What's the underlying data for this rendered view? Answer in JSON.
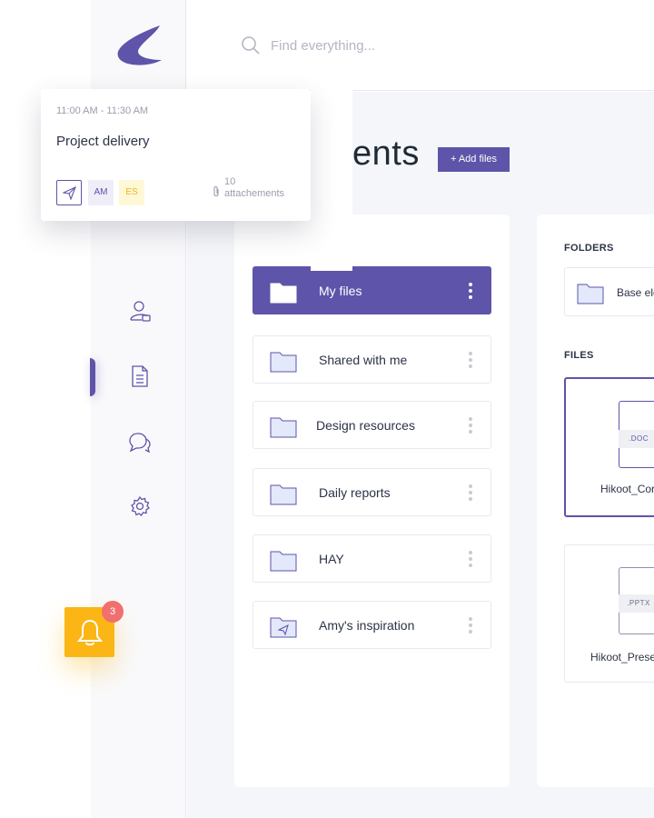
{
  "app": {
    "brand_color": "#5e54a9",
    "accent_yellow": "#fbb616",
    "badge_red": "#f0706d"
  },
  "search": {
    "placeholder": "Find everything..."
  },
  "page": {
    "title_visible": "ents",
    "add_files_label": "+ Add files"
  },
  "sidebar": {
    "icons": [
      "user-badge-icon",
      "document-icon",
      "chat-icon",
      "gear-icon"
    ],
    "active_item": "document-icon"
  },
  "folder_list": [
    {
      "label": "My files",
      "icon": "folder-icon",
      "active": true
    },
    {
      "label": "Shared with me",
      "icon": "folder-icon",
      "active": false
    },
    {
      "label": "Design resources",
      "icon": "folder-icon",
      "active": false
    },
    {
      "label": "Daily reports",
      "icon": "folder-icon",
      "active": false
    },
    {
      "label": "HAY",
      "icon": "folder-icon",
      "active": false
    },
    {
      "label": "Amy's inspiration",
      "icon": "send-folder-icon",
      "active": false
    }
  ],
  "right_panel": {
    "folders_heading": "FOLDERS",
    "files_heading": "FILES",
    "folders": [
      {
        "label": "Base ele"
      }
    ],
    "files": [
      {
        "ext": ".DOC",
        "name": "Hikoot_Cor",
        "selected": true
      },
      {
        "ext": ".PPTX",
        "name": "Hikoot_Prese",
        "selected": false
      }
    ]
  },
  "event_card": {
    "time": "11:00 AM - 11:30 AM",
    "title": "Project delivery",
    "chips": [
      "AM",
      "ES"
    ],
    "attachments_count": "10",
    "attachments_label": "attachements"
  },
  "notifications": {
    "count": "3"
  }
}
